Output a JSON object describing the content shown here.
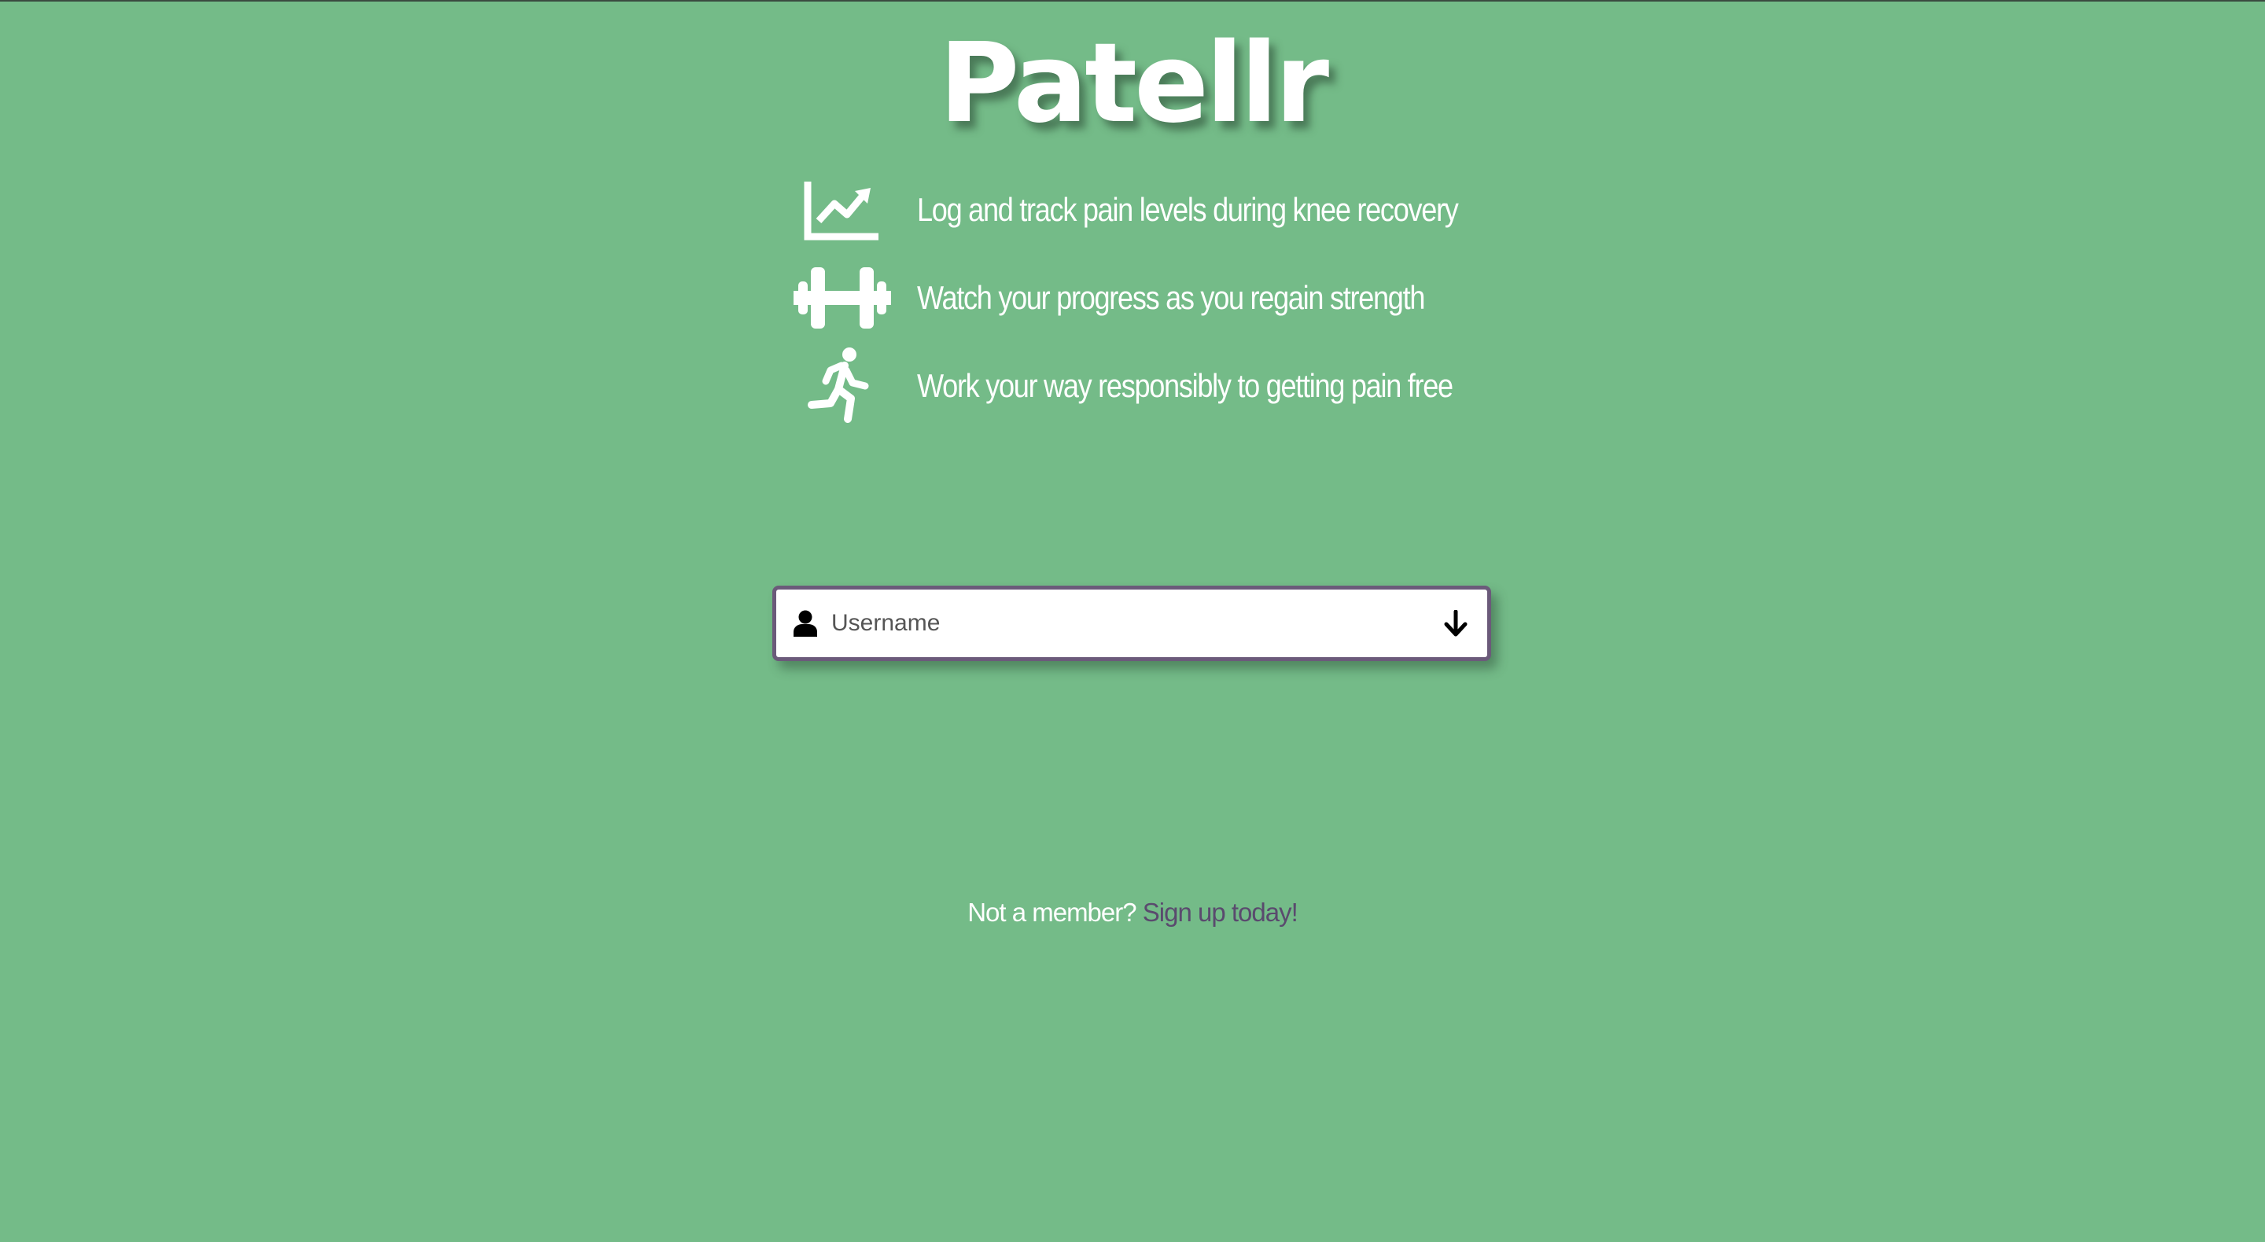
{
  "app": {
    "brand": "Patellr"
  },
  "features": [
    {
      "icon": "chart-line-icon",
      "text": "Log and track pain levels during knee recovery"
    },
    {
      "icon": "dumbbell-icon",
      "text": "Watch your progress as you regain strength"
    },
    {
      "icon": "running-icon",
      "text": "Work your way responsibly to getting pain free"
    }
  ],
  "login": {
    "username_placeholder": "Username",
    "username_value": "",
    "user_icon": "user-icon",
    "submit_icon": "arrow-down-icon"
  },
  "signup": {
    "prompt": "Not a member?",
    "link_label": "Sign up today!"
  },
  "colors": {
    "background": "#74bb88",
    "accent": "#6b5a7a",
    "link": "#5a4a6e",
    "text": "#ffffff"
  }
}
